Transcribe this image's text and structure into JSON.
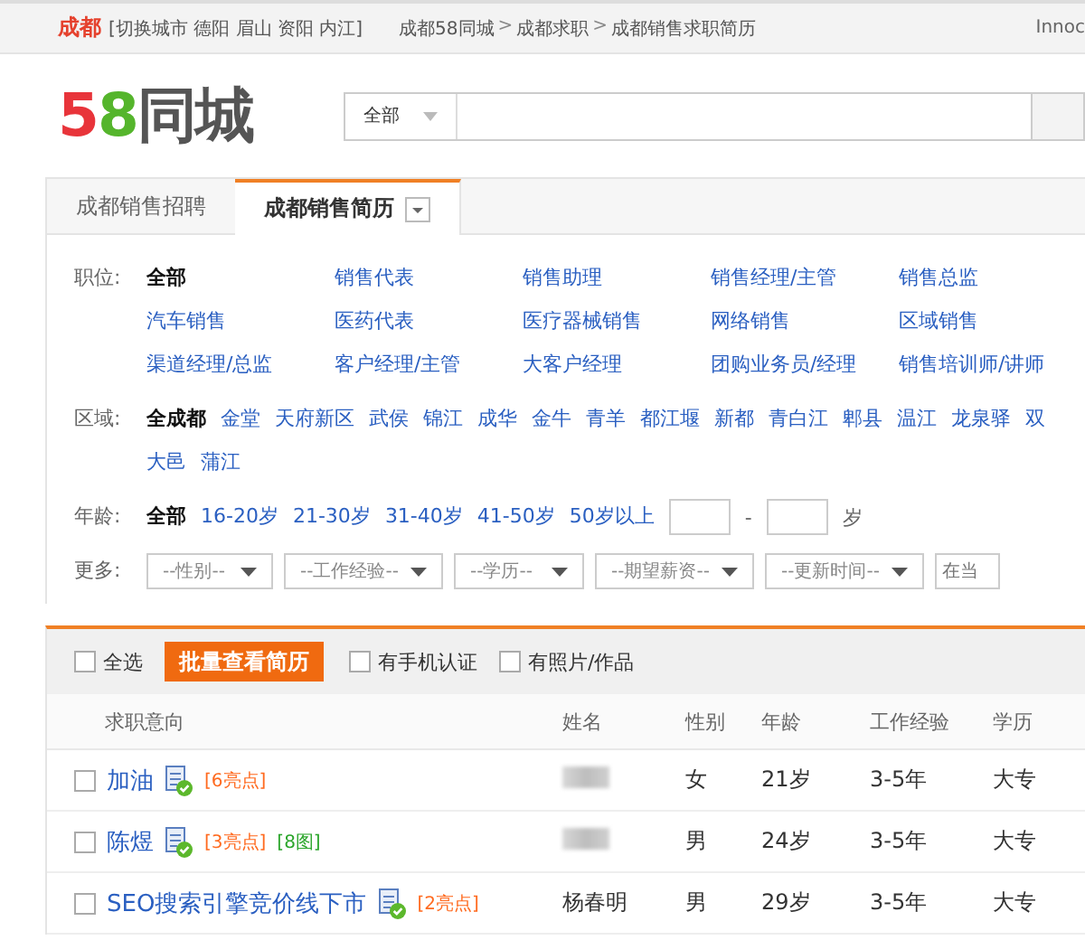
{
  "top_bar": {
    "city": "成都",
    "city_links": "[切换城市  德阳  眉山  资阳  内江]",
    "breadcrumb": [
      "成都58同城",
      "成都求职",
      "成都销售求职简历"
    ],
    "breadcrumb_sep": ">",
    "user": "Innoc"
  },
  "logo": "58同城",
  "search": {
    "category": "全部"
  },
  "tabs": [
    {
      "label": "成都销售招聘",
      "selected": false,
      "dropdown": false
    },
    {
      "label": "成都销售简历",
      "selected": true,
      "dropdown": true
    }
  ],
  "filters": {
    "position": {
      "label": "职位:",
      "items": [
        {
          "text": "全部",
          "selected": true
        },
        {
          "text": "销售代表",
          "selected": false
        },
        {
          "text": "销售助理",
          "selected": false
        },
        {
          "text": "销售经理/主管",
          "selected": false
        },
        {
          "text": "销售总监",
          "selected": false
        },
        {
          "text": "汽车销售",
          "selected": false
        },
        {
          "text": "医药代表",
          "selected": false
        },
        {
          "text": "医疗器械销售",
          "selected": false
        },
        {
          "text": "网络销售",
          "selected": false
        },
        {
          "text": "区域销售",
          "selected": false
        },
        {
          "text": "渠道经理/总监",
          "selected": false
        },
        {
          "text": "客户经理/主管",
          "selected": false
        },
        {
          "text": "大客户经理",
          "selected": false
        },
        {
          "text": "团购业务员/经理",
          "selected": false
        },
        {
          "text": "销售培训师/讲师",
          "selected": false
        }
      ]
    },
    "area": {
      "label": "区域:",
      "rows": [
        [
          {
            "text": "全成都",
            "selected": true
          },
          {
            "text": "金堂",
            "selected": false
          },
          {
            "text": "天府新区",
            "selected": false
          },
          {
            "text": "武侯",
            "selected": false
          },
          {
            "text": "锦江",
            "selected": false
          },
          {
            "text": "成华",
            "selected": false
          },
          {
            "text": "金牛",
            "selected": false
          },
          {
            "text": "青羊",
            "selected": false
          },
          {
            "text": "都江堰",
            "selected": false
          },
          {
            "text": "新都",
            "selected": false
          },
          {
            "text": "青白江",
            "selected": false
          },
          {
            "text": "郫县",
            "selected": false
          },
          {
            "text": "温江",
            "selected": false
          },
          {
            "text": "龙泉驿",
            "selected": false
          },
          {
            "text": "双",
            "selected": false
          }
        ],
        [
          {
            "text": "大邑",
            "selected": false
          },
          {
            "text": "蒲江",
            "selected": false
          }
        ]
      ]
    },
    "age": {
      "label": "年龄:",
      "items": [
        {
          "text": "全部",
          "selected": true
        },
        {
          "text": "16-20岁",
          "selected": false
        },
        {
          "text": "21-30岁",
          "selected": false
        },
        {
          "text": "31-40岁",
          "selected": false
        },
        {
          "text": "41-50岁",
          "selected": false
        },
        {
          "text": "50岁以上",
          "selected": false
        }
      ],
      "range_sep": "-",
      "unit": "岁"
    },
    "more": {
      "label": "更多:",
      "selects": [
        "--性别--",
        "--工作经验--",
        "--学历--",
        "--期望薪资--",
        "--更新时间--"
      ],
      "search_placeholder": "在当"
    }
  },
  "toolbar": {
    "select_all": {
      "label": "全选",
      "checked": false
    },
    "batch_button": "批量查看简历",
    "options": [
      {
        "label": "有手机认证",
        "checked": false
      },
      {
        "label": "有照片/作品",
        "checked": false
      }
    ]
  },
  "table": {
    "columns": [
      "求职意向",
      "姓名",
      "性别",
      "年龄",
      "工作经验",
      "学历"
    ],
    "rows": [
      {
        "checked": false,
        "title": "加油",
        "verified": true,
        "tags": [
          {
            "text": "[6亮点]",
            "color": "#ff6a1f"
          }
        ],
        "name": "",
        "name_blurred": true,
        "gender": "女",
        "age": "21岁",
        "experience": "3-5年",
        "education": "大专"
      },
      {
        "checked": false,
        "title": "陈煜",
        "verified": true,
        "tags": [
          {
            "text": "[3亮点]",
            "color": "#ff6a1f"
          },
          {
            "text": "[8图]",
            "color": "#2aa52a"
          }
        ],
        "name": "",
        "name_blurred": true,
        "gender": "男",
        "age": "24岁",
        "experience": "3-5年",
        "education": "大专"
      },
      {
        "checked": false,
        "title": "SEO搜索引擎竞价线下市",
        "verified": true,
        "tags": [
          {
            "text": "[2亮点]",
            "color": "#ff6a1f"
          }
        ],
        "name": "杨春明",
        "name_blurred": false,
        "gender": "男",
        "age": "29岁",
        "experience": "3-5年",
        "education": "大专"
      }
    ]
  }
}
